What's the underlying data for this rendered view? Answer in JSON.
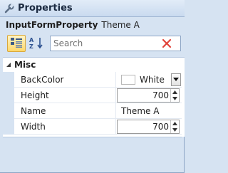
{
  "window": {
    "title": "Properties",
    "icon": "wrench-icon"
  },
  "object": {
    "type": "InputFormProperty",
    "name": "Theme A"
  },
  "toolbar": {
    "categorized_icon": "categorized-icon",
    "alphabetical_icon": "sort-alphabetical-icon",
    "search": {
      "placeholder": "Search",
      "value": "",
      "clear_icon": "clear-x-icon"
    }
  },
  "grid": {
    "category": {
      "label": "Misc",
      "icon": "chevron-down-icon"
    },
    "properties": [
      {
        "name": "BackColor",
        "value": "White",
        "editor": "color",
        "swatch": "#ffffff"
      },
      {
        "name": "Height",
        "value": "700",
        "editor": "spin"
      },
      {
        "name": "Name",
        "value": "Theme A",
        "editor": "text"
      },
      {
        "name": "Width",
        "value": "700",
        "editor": "spin"
      }
    ]
  },
  "colors": {
    "panel_background": "#d6e3f2",
    "active_button": "#ffd86a",
    "clear_icon": "#e0433a"
  }
}
